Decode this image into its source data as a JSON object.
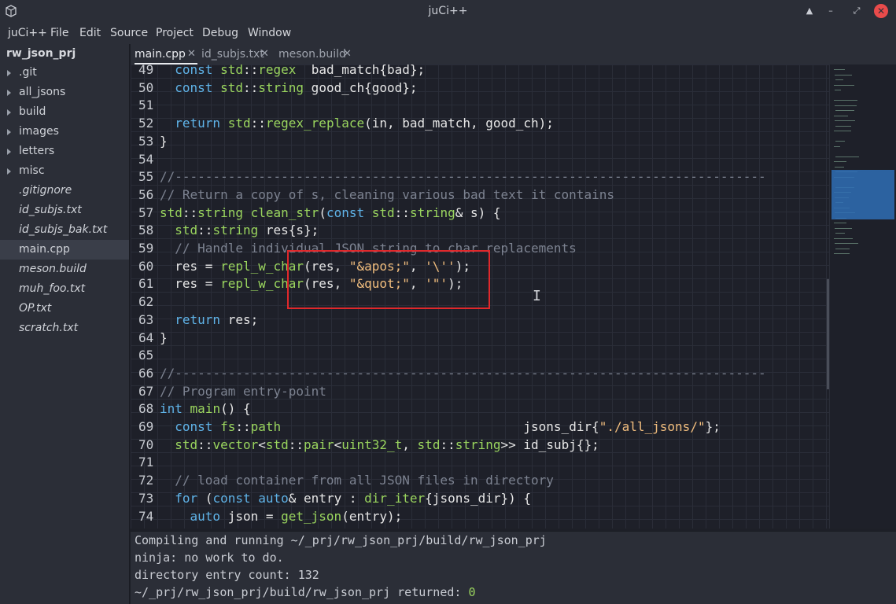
{
  "window": {
    "title": "juCi++",
    "controls": [
      "▲",
      "–",
      "⤢",
      "✕"
    ]
  },
  "menu": [
    "juCi++",
    "File",
    "Edit",
    "Source",
    "Project",
    "Debug",
    "Window"
  ],
  "sidebar": {
    "project": "rw_json_prj",
    "items": [
      {
        "label": ".git",
        "type": "folder"
      },
      {
        "label": "all_jsons",
        "type": "folder"
      },
      {
        "label": "build",
        "type": "folder"
      },
      {
        "label": "images",
        "type": "folder"
      },
      {
        "label": "letters",
        "type": "folder"
      },
      {
        "label": "misc",
        "type": "folder"
      },
      {
        "label": ".gitignore",
        "type": "file"
      },
      {
        "label": "id_subjs.txt",
        "type": "file"
      },
      {
        "label": "id_subjs_bak.txt",
        "type": "file"
      },
      {
        "label": "main.cpp",
        "type": "file",
        "active": true
      },
      {
        "label": "meson.build",
        "type": "file"
      },
      {
        "label": "muh_foo.txt",
        "type": "file"
      },
      {
        "label": "OP.txt",
        "type": "file"
      },
      {
        "label": "scratch.txt",
        "type": "file"
      }
    ]
  },
  "tabs": [
    {
      "label": "main.cpp",
      "active": true,
      "close": "✕"
    },
    {
      "label": "id_subjs.txt",
      "active": false,
      "close": "✕"
    },
    {
      "label": "meson.build",
      "active": false,
      "close": "✕"
    }
  ],
  "editor": {
    "lines": [
      {
        "n": "49",
        "code": "  const std::regex  bad_match{bad};"
      },
      {
        "n": "50",
        "code": "  const std::string good_ch{good};"
      },
      {
        "n": "51",
        "code": ""
      },
      {
        "n": "52",
        "code": "  return std::regex_replace(in, bad_match, good_ch);"
      },
      {
        "n": "53",
        "code": "}"
      },
      {
        "n": "54",
        "code": ""
      },
      {
        "n": "55",
        "code": "//------------------------------------------------------------------------------"
      },
      {
        "n": "56",
        "code": "// Return a copy of s, cleaning various bad text it contains"
      },
      {
        "n": "57",
        "code": "std::string clean_str(const std::string& s) {"
      },
      {
        "n": "58",
        "code": "  std::string res{s};"
      },
      {
        "n": "59",
        "code": "  // Handle individual JSON string to char replacements"
      },
      {
        "n": "60",
        "code": "  res = repl_w_char(res, \"&apos;\", '\\'');"
      },
      {
        "n": "61",
        "code": "  res = repl_w_char(res, \"&quot;\", '\"');"
      },
      {
        "n": "62",
        "code": ""
      },
      {
        "n": "63",
        "code": "  return res;"
      },
      {
        "n": "64",
        "code": "}"
      },
      {
        "n": "65",
        "code": ""
      },
      {
        "n": "66",
        "code": "//------------------------------------------------------------------------------"
      },
      {
        "n": "67",
        "code": "// Program entry-point"
      },
      {
        "n": "68",
        "code": "int main() {"
      },
      {
        "n": "69",
        "code": "  const fs::path                                jsons_dir{\"./all_jsons/\"};"
      },
      {
        "n": "70",
        "code": "  std::vector<std::pair<uint32_t, std::string>> id_subj{};"
      },
      {
        "n": "71",
        "code": ""
      },
      {
        "n": "72",
        "code": "  // load container from all JSON files in directory"
      },
      {
        "n": "73",
        "code": "  for (const auto& entry : dir_iter{jsons_dir}) {"
      },
      {
        "n": "74",
        "code": "    auto json = get_json(entry);"
      }
    ]
  },
  "terminal": {
    "lines": [
      "Compiling and running ~/_prj/rw_json_prj/build/rw_json_prj",
      "ninja: no work to do.",
      "directory entry count: 132"
    ],
    "last_prefix": "~/_prj/rw_json_prj/build/rw_json_prj returned: ",
    "last_value": "0"
  },
  "colors": {
    "keyword": "#5fb3e8",
    "type_and_function": "#9ad55e",
    "string": "#f2be7e",
    "comment": "#7c8290",
    "highlight_box": "#e0282b"
  }
}
